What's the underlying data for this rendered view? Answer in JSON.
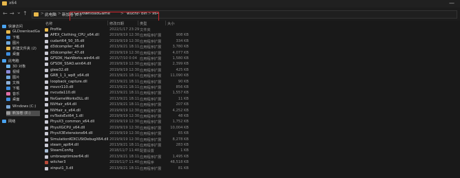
{
  "window": {
    "title": "x64",
    "minimize_glyph": "—"
  },
  "nav": {
    "back_glyph": "←",
    "forward_glyph": "→",
    "dropdown_glyph": "⌄",
    "up_glyph": "↑",
    "breadcrumb": [
      {
        "label": "此电脑"
      },
      {
        "label": "新加卷 (E:)"
      },
      {
        "label": "GLDownloadGame"
      },
      {
        "label": "wuchi"
      },
      {
        "label": "bin"
      },
      {
        "label": "x64"
      }
    ],
    "separator": ">"
  },
  "sidebar": {
    "items": [
      {
        "label": "快速访问",
        "icon": "star-icon",
        "color": "#4aa3f0"
      },
      {
        "label": "GLDownloadGame",
        "icon": "folder-icon",
        "color": "#e8b84a"
      },
      {
        "label": "下载",
        "icon": "download-icon",
        "color": "#3d8ee0"
      },
      {
        "label": "图片",
        "icon": "pictures-icon",
        "color": "#6fa8dc"
      },
      {
        "label": "新建文件夹 (2)",
        "icon": "folder-icon",
        "color": "#e8b84a"
      },
      {
        "label": "桌面",
        "icon": "desktop-icon",
        "color": "#3d8ee0"
      },
      {
        "label": "此电脑",
        "icon": "computer-icon",
        "color": "#4aa3f0"
      },
      {
        "label": "3D 对象",
        "icon": "cube-icon",
        "color": "#6fb3e8"
      },
      {
        "label": "视频",
        "icon": "video-icon",
        "color": "#8a8ad8"
      },
      {
        "label": "图片",
        "icon": "pictures-icon",
        "color": "#6fa8dc"
      },
      {
        "label": "文档",
        "icon": "document-icon",
        "color": "#8db0d8"
      },
      {
        "label": "下载",
        "icon": "download-icon",
        "color": "#3d8ee0"
      },
      {
        "label": "音乐",
        "icon": "music-icon",
        "color": "#e06fa8"
      },
      {
        "label": "桌面",
        "icon": "desktop-icon",
        "color": "#3d8ee0"
      },
      {
        "label": "Windows (C:)",
        "icon": "drive-icon",
        "color": "#7aa7d6"
      },
      {
        "label": "新加卷 (E:)",
        "icon": "drive-icon",
        "color": "#9a9a9a"
      },
      {
        "label": "网络",
        "icon": "network-icon",
        "color": "#4aa3f0"
      }
    ]
  },
  "columns": {
    "name": "名称",
    "date": "修改日期",
    "type": "类型",
    "size": "大小"
  },
  "files": [
    {
      "name": "Profile",
      "date": "2022/1/17 23:29",
      "type": "文件夹",
      "size": "",
      "kind": "folder"
    },
    {
      "name": "APEX_Clothing_CPU_x64.dll",
      "date": "2019/9/19 12:30",
      "type": "应用程序扩展",
      "size": "908 KB",
      "kind": "dll"
    },
    {
      "name": "cudart64_50_35.dll",
      "date": "2019/9/19 12:30",
      "type": "应用程序扩展",
      "size": "334 KB",
      "kind": "dll"
    },
    {
      "name": "d3dcompiler_46.dll",
      "date": "2013/9/21 18:11",
      "type": "应用程序扩展",
      "size": "3,780 KB",
      "kind": "dll"
    },
    {
      "name": "d3dcompiler_47.dll",
      "date": "2019/9/19 12:30",
      "type": "应用程序扩展",
      "size": "4,077 KB",
      "kind": "dll"
    },
    {
      "name": "GFSDK_HairWorks.win64.dll",
      "date": "2015/7/10 0:04",
      "type": "应用程序扩展",
      "size": "1,580 KB",
      "kind": "dll"
    },
    {
      "name": "GFSDK_SSAO.win64.dll",
      "date": "2019/9/19 12:30",
      "type": "应用程序扩展",
      "size": "2,399 KB",
      "kind": "dll"
    },
    {
      "name": "glew32.dll",
      "date": "2019/9/19 12:30",
      "type": "应用程序扩展",
      "size": "425 KB",
      "kind": "dll"
    },
    {
      "name": "GRB_1_1_wp8_x64.dll",
      "date": "2013/9/21 18:11",
      "type": "应用程序扩展",
      "size": "11,090 KB",
      "kind": "dll"
    },
    {
      "name": "loopback_capture.dll",
      "date": "2013/9/21 18:11",
      "type": "应用程序扩展",
      "size": "90 KB",
      "kind": "dll"
    },
    {
      "name": "msvcr110.dll",
      "date": "2013/9/21 18:11",
      "type": "应用程序扩展",
      "size": "856 KB",
      "kind": "dll"
    },
    {
      "name": "nvcuda110.dll",
      "date": "2013/9/21 18:11",
      "type": "应用程序扩展",
      "size": "1,557 KB",
      "kind": "dll"
    },
    {
      "name": "NvGameWorksDLL.dll",
      "date": "2013/9/21 18:11",
      "type": "应用程序扩展",
      "size": "11 KB",
      "kind": "dll"
    },
    {
      "name": "NVHair_x64.dll",
      "date": "2013/9/21 18:11",
      "type": "应用程序扩展",
      "size": "207 KB",
      "kind": "dll"
    },
    {
      "name": "NVHair_x_x64.dll",
      "date": "2019/9/19 12:30",
      "type": "应用程序扩展",
      "size": "4,252 KB",
      "kind": "dll"
    },
    {
      "name": "nvToolsExt64_1.dll",
      "date": "2019/9/19 12:30",
      "type": "应用程序扩展",
      "size": "48 KB",
      "kind": "dll"
    },
    {
      "name": "PhysX3_common_x64.dll",
      "date": "2019/9/19 12:30",
      "type": "应用程序扩展",
      "size": "1,752 KB",
      "kind": "dll"
    },
    {
      "name": "PhysXGCPU_x64.dll",
      "date": "2019/9/19 12:30",
      "type": "应用程序扩展",
      "size": "10,004 KB",
      "kind": "dll"
    },
    {
      "name": "PhysX3Extensions64.dll",
      "date": "2019/9/19 12:30",
      "type": "应用程序扩展",
      "size": "65 KB",
      "kind": "dll"
    },
    {
      "name": "SimulationKDICUStDebugX64.dll",
      "date": "2019/9/19 12:30",
      "type": "应用程序扩展",
      "size": "8,278 KB",
      "kind": "dll"
    },
    {
      "name": "steam_api64.dll",
      "date": "2013/9/21 18:11",
      "type": "应用程序扩展",
      "size": "283 KB",
      "kind": "dll"
    },
    {
      "name": "SteamConfig",
      "date": "2018/11/7 11:40",
      "type": "配置设置",
      "size": "1 KB",
      "kind": "config"
    },
    {
      "name": "umbraoptimizer64.dll",
      "date": "2013/9/21 18:11",
      "type": "应用程序扩展",
      "size": "1,495 KB",
      "kind": "dll"
    },
    {
      "name": "witcher3",
      "date": "2019/11/7 11:40",
      "type": "应用程序",
      "size": "48,518 KB",
      "kind": "exe"
    },
    {
      "name": "xinput1_3.dll",
      "date": "2013/9/21 18:11",
      "type": "应用程序扩展",
      "size": "81 KB",
      "kind": "dll"
    }
  ],
  "colors": {
    "highlight": "#d7262e",
    "folder": "#e8b84a",
    "dll": "#c9c9d4",
    "config": "#a7bcd4",
    "exe": "#b84a3a"
  }
}
